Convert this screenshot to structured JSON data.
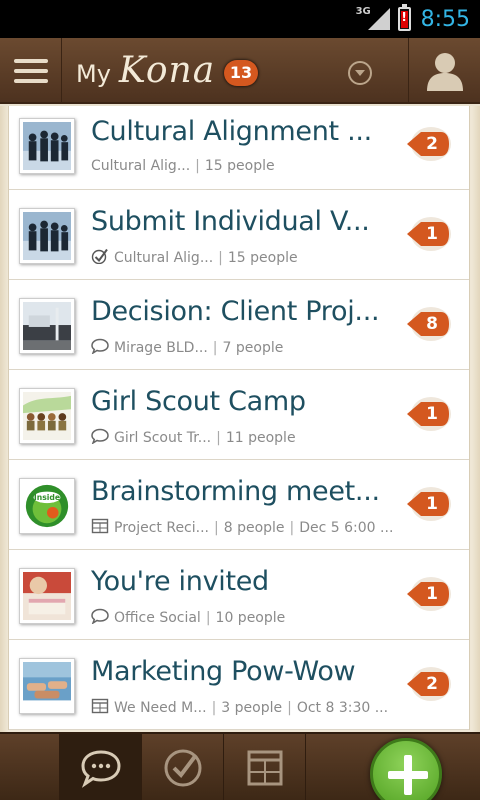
{
  "status_bar": {
    "network": "3G",
    "time": "8:55"
  },
  "app_bar": {
    "brand_prefix": "My",
    "brand_name": "Kona",
    "notification_count": "13"
  },
  "list": [
    {
      "title": "Cultural Alignment ...",
      "context_icon": "none",
      "context": "Cultural Alig...",
      "people": "15 people",
      "extra": "",
      "badge": "2",
      "thumb": "business-silhouettes"
    },
    {
      "title": "Submit Individual V...",
      "context_icon": "check-icon",
      "context": "Cultural Alig...",
      "people": "15 people",
      "extra": "",
      "badge": "1",
      "thumb": "business-silhouettes"
    },
    {
      "title": "Decision: Client Proj...",
      "context_icon": "chat-icon",
      "context": "Mirage BLD...",
      "people": "7 people",
      "extra": "",
      "badge": "8",
      "thumb": "building"
    },
    {
      "title": "Girl Scout Camp",
      "context_icon": "chat-icon",
      "context": "Girl Scout Tr...",
      "people": "11 people",
      "extra": "",
      "badge": "1",
      "thumb": "scouts"
    },
    {
      "title": "Brainstorming meet...",
      "context_icon": "calendar-icon",
      "context": "Project Reci...",
      "people": "8 people",
      "extra": "Dec 5 6:00 ...",
      "badge": "1",
      "thumb": "inside-logo"
    },
    {
      "title": "You're invited",
      "context_icon": "chat-icon",
      "context": "Office Social",
      "people": "10 people",
      "extra": "",
      "badge": "1",
      "thumb": "cake"
    },
    {
      "title": "Marketing Pow-Wow",
      "context_icon": "calendar-icon",
      "context": "We Need M...",
      "people": "3 people",
      "extra": "Oct 8 3:30 ...",
      "badge": "2",
      "thumb": "hands"
    }
  ],
  "bottom_tabs": [
    {
      "icon": "conversations-icon",
      "active": true
    },
    {
      "icon": "tasks-icon",
      "active": false
    },
    {
      "icon": "calendar-icon",
      "active": false
    }
  ],
  "colors": {
    "title": "#1e4f60",
    "badge": "#d4581f",
    "fab": "#5cb82a"
  }
}
